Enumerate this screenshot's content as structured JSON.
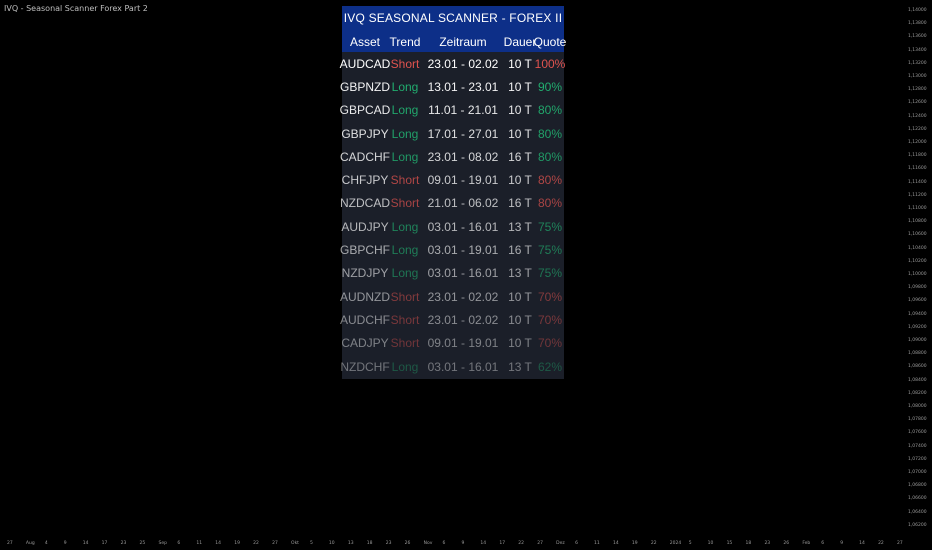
{
  "chart_title": "IVQ - Seasonal Scanner Forex Part 2",
  "scanner": {
    "title": "IVQ SEASONAL SCANNER - FOREX II",
    "headers": [
      "Asset",
      "Trend",
      "Zeitraum",
      "Dauer",
      "Quote"
    ],
    "rows": [
      {
        "asset": "AUDCAD",
        "trend": "Short",
        "period": "23.01 - 02.02",
        "duration": "10 T",
        "quote": "100%"
      },
      {
        "asset": "GBPNZD",
        "trend": "Long",
        "period": "13.01 - 23.01",
        "duration": "10 T",
        "quote": "90%"
      },
      {
        "asset": "GBPCAD",
        "trend": "Long",
        "period": "11.01 - 21.01",
        "duration": "10 T",
        "quote": "80%"
      },
      {
        "asset": "GBPJPY",
        "trend": "Long",
        "period": "17.01 - 27.01",
        "duration": "10 T",
        "quote": "80%"
      },
      {
        "asset": "CADCHF",
        "trend": "Long",
        "period": "23.01 - 08.02",
        "duration": "16 T",
        "quote": "80%"
      },
      {
        "asset": "CHFJPY",
        "trend": "Short",
        "period": "09.01 - 19.01",
        "duration": "10 T",
        "quote": "80%"
      },
      {
        "asset": "NZDCAD",
        "trend": "Short",
        "period": "21.01 - 06.02",
        "duration": "16 T",
        "quote": "80%"
      },
      {
        "asset": "AUDJPY",
        "trend": "Long",
        "period": "03.01 - 16.01",
        "duration": "13 T",
        "quote": "75%"
      },
      {
        "asset": "GBPCHF",
        "trend": "Long",
        "period": "03.01 - 19.01",
        "duration": "16 T",
        "quote": "75%"
      },
      {
        "asset": "NZDJPY",
        "trend": "Long",
        "period": "03.01 - 16.01",
        "duration": "13 T",
        "quote": "75%"
      },
      {
        "asset": "AUDNZD",
        "trend": "Short",
        "period": "23.01 - 02.02",
        "duration": "10 T",
        "quote": "70%"
      },
      {
        "asset": "AUDCHF",
        "trend": "Short",
        "period": "23.01 - 02.02",
        "duration": "10 T",
        "quote": "70%"
      },
      {
        "asset": "CADJPY",
        "trend": "Short",
        "period": "09.01 - 19.01",
        "duration": "10 T",
        "quote": "70%"
      },
      {
        "asset": "NZDCHF",
        "trend": "Long",
        "period": "03.01 - 16.01",
        "duration": "13 T",
        "quote": "62%"
      }
    ]
  },
  "colors": {
    "long": "#22b573",
    "short": "#e0534f",
    "header_bg": "#0d2f88",
    "panel_bg": "#1b1f29"
  },
  "y_axis_labels": [
    "1,14000",
    "1,13800",
    "1,13600",
    "1,13400",
    "1,13200",
    "1,13000",
    "1,12800",
    "1,12600",
    "1,12400",
    "1,12200",
    "1,12000",
    "1,11800",
    "1,11600",
    "1,11400",
    "1,11200",
    "1,11000",
    "1,10800",
    "1,10600",
    "1,10400",
    "1,10200",
    "1,10000",
    "1,09800",
    "1,09600",
    "1,09400",
    "1,09200",
    "1,09000",
    "1,08800",
    "1,08600",
    "1,08400",
    "1,08200",
    "1,08000",
    "1,07800",
    "1,07600",
    "1,07400",
    "1,07200",
    "1,07000",
    "1,06800",
    "1,06600",
    "1,06400",
    "1,06200"
  ],
  "x_axis_labels": [
    "27",
    "Aug",
    "4",
    "9",
    "14",
    "17",
    "23",
    "25",
    "Sep",
    "6",
    "11",
    "14",
    "19",
    "22",
    "27",
    "Okt",
    "5",
    "10",
    "13",
    "18",
    "23",
    "26",
    "Nov",
    "6",
    "9",
    "14",
    "17",
    "22",
    "27",
    "Dez",
    "6",
    "11",
    "14",
    "19",
    "22",
    "2024",
    "5",
    "10",
    "15",
    "18",
    "23",
    "26",
    "Feb",
    "6",
    "9",
    "14",
    "22",
    "27"
  ]
}
